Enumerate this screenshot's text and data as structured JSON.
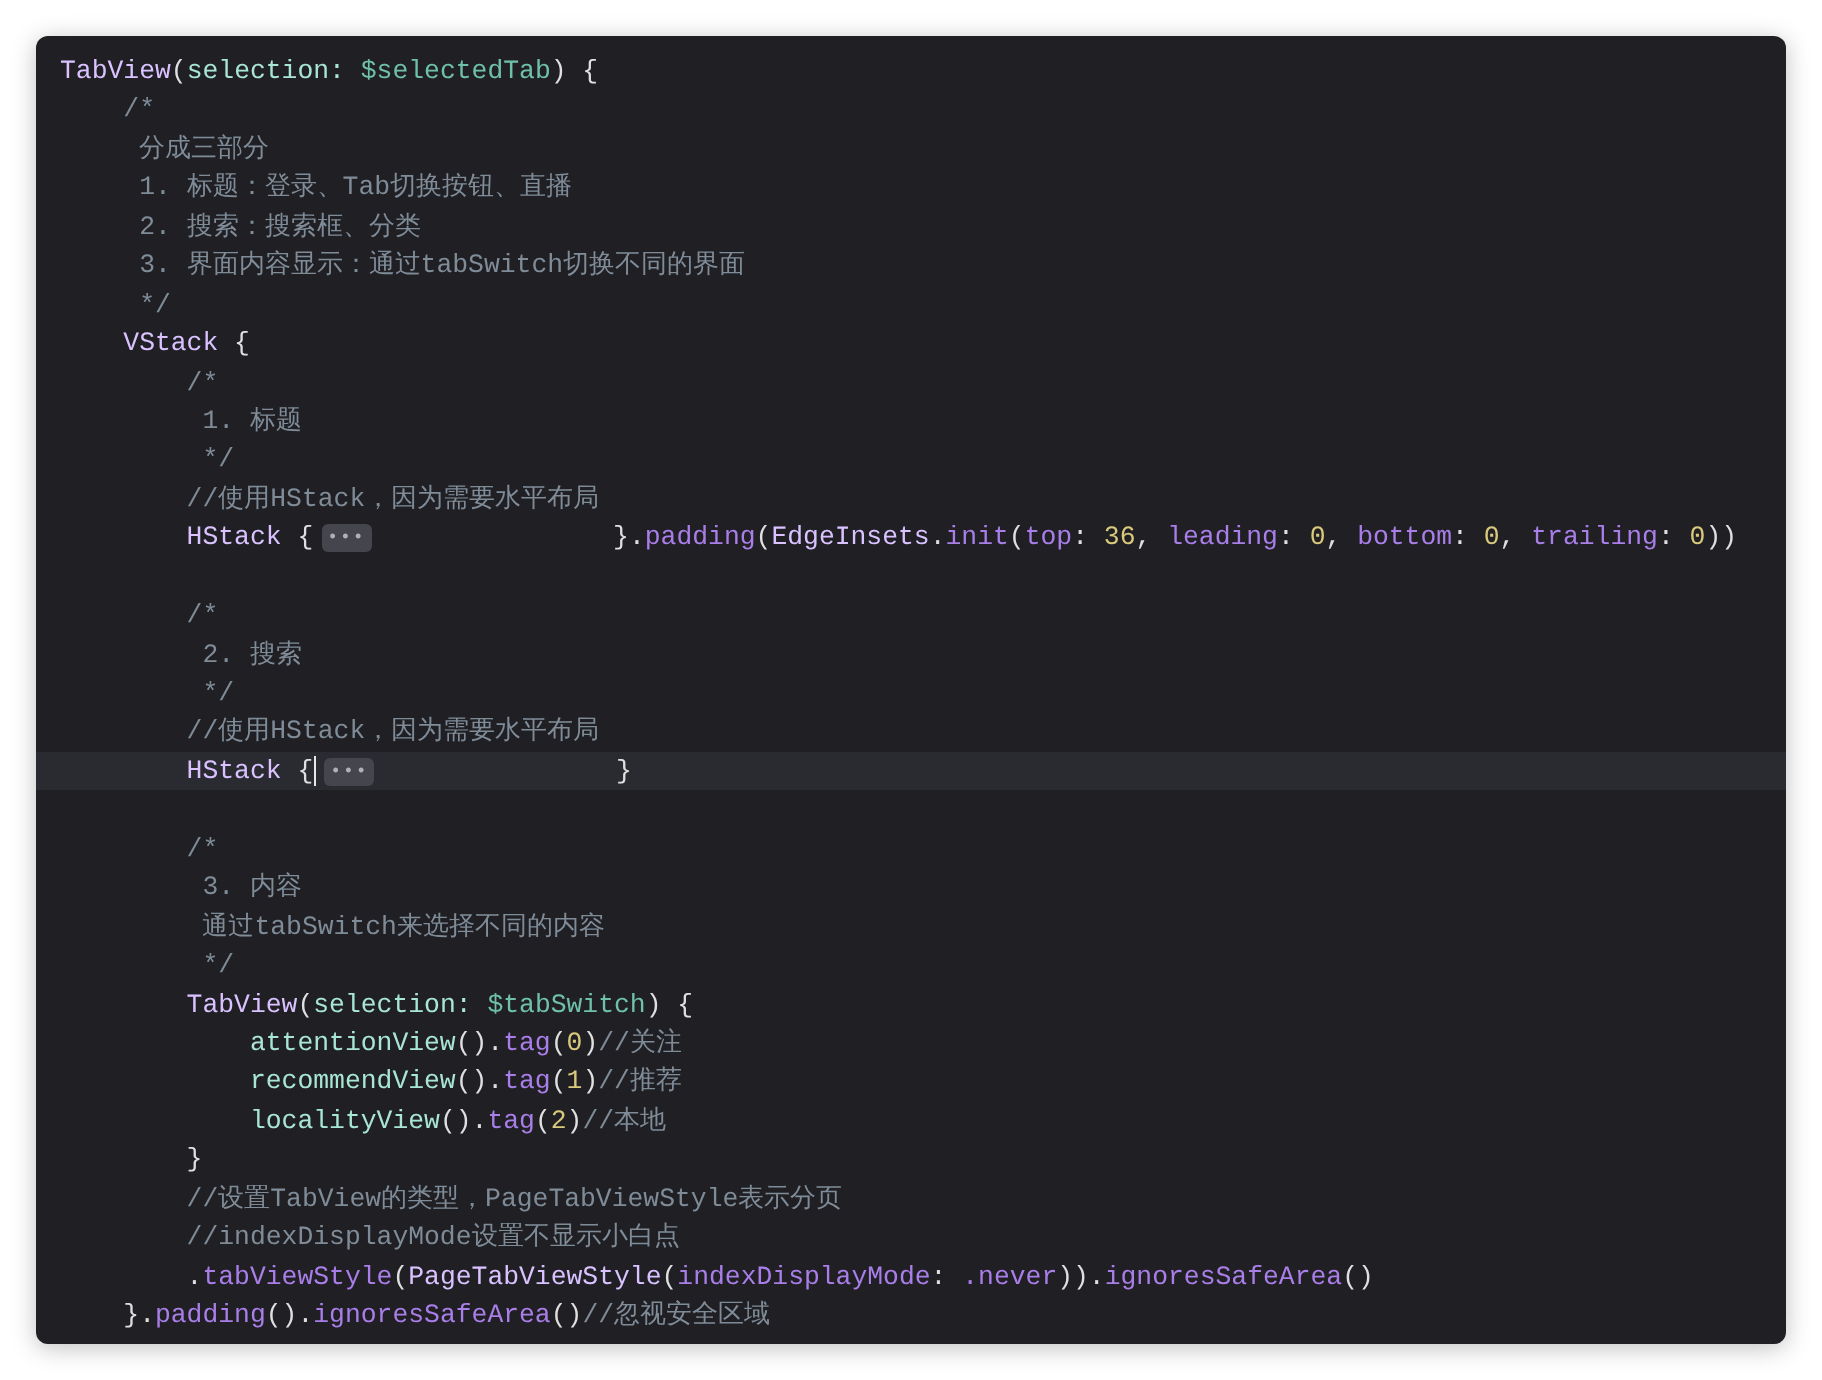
{
  "editor": {
    "lines": [
      {
        "current": false,
        "tokens": [
          {
            "text": "TabView",
            "kind": "type"
          },
          {
            "text": "(",
            "kind": "plain"
          },
          {
            "text": "selection: ",
            "kind": "param"
          },
          {
            "text": "$selectedTab",
            "kind": "var"
          },
          {
            "text": ") {",
            "kind": "plain"
          }
        ]
      },
      {
        "current": false,
        "tokens": [
          {
            "text": "    /*",
            "kind": "comment"
          }
        ]
      },
      {
        "current": false,
        "tokens": [
          {
            "text": "     分成三部分",
            "kind": "comment"
          }
        ]
      },
      {
        "current": false,
        "tokens": [
          {
            "text": "     1. 标题：登录、Tab切换按钮、直播",
            "kind": "comment"
          }
        ]
      },
      {
        "current": false,
        "tokens": [
          {
            "text": "     2. 搜索：搜索框、分类",
            "kind": "comment"
          }
        ]
      },
      {
        "current": false,
        "tokens": [
          {
            "text": "     3. 界面内容显示：通过tabSwitch切换不同的界面",
            "kind": "comment"
          }
        ]
      },
      {
        "current": false,
        "tokens": [
          {
            "text": "     */",
            "kind": "comment"
          }
        ]
      },
      {
        "current": false,
        "tokens": [
          {
            "text": "    VStack",
            "kind": "type"
          },
          {
            "text": " {",
            "kind": "plain"
          }
        ]
      },
      {
        "current": false,
        "tokens": [
          {
            "text": "        /*",
            "kind": "comment"
          }
        ]
      },
      {
        "current": false,
        "tokens": [
          {
            "text": "         1. 标题",
            "kind": "comment"
          }
        ]
      },
      {
        "current": false,
        "tokens": [
          {
            "text": "         */",
            "kind": "comment"
          }
        ]
      },
      {
        "current": false,
        "tokens": [
          {
            "text": "        //使用HStack，因为需要水平布局",
            "kind": "comment"
          }
        ]
      },
      {
        "current": false,
        "tokens": [
          {
            "text": "        HStack",
            "kind": "type"
          },
          {
            "text": " {",
            "kind": "plain"
          },
          {
            "text": "•••",
            "kind": "fold"
          },
          {
            "text": "               }.",
            "kind": "plain"
          },
          {
            "text": "padding",
            "kind": "method"
          },
          {
            "text": "(",
            "kind": "plain"
          },
          {
            "text": "EdgeInsets",
            "kind": "type"
          },
          {
            "text": ".",
            "kind": "plain"
          },
          {
            "text": "init",
            "kind": "method"
          },
          {
            "text": "(",
            "kind": "plain"
          },
          {
            "text": "top",
            "kind": "label"
          },
          {
            "text": ": ",
            "kind": "plain"
          },
          {
            "text": "36",
            "kind": "number"
          },
          {
            "text": ", ",
            "kind": "plain"
          },
          {
            "text": "leading",
            "kind": "label"
          },
          {
            "text": ": ",
            "kind": "plain"
          },
          {
            "text": "0",
            "kind": "number"
          },
          {
            "text": ", ",
            "kind": "plain"
          },
          {
            "text": "bottom",
            "kind": "label"
          },
          {
            "text": ": ",
            "kind": "plain"
          },
          {
            "text": "0",
            "kind": "number"
          },
          {
            "text": ", ",
            "kind": "plain"
          },
          {
            "text": "trailing",
            "kind": "label"
          },
          {
            "text": ": ",
            "kind": "plain"
          },
          {
            "text": "0",
            "kind": "number"
          },
          {
            "text": "))",
            "kind": "plain"
          }
        ]
      },
      {
        "current": false
      },
      {
        "current": false,
        "tokens": [
          {
            "text": "        /*",
            "kind": "comment"
          }
        ]
      },
      {
        "current": false,
        "tokens": [
          {
            "text": "         2. 搜索",
            "kind": "comment"
          }
        ]
      },
      {
        "current": false,
        "tokens": [
          {
            "text": "         */",
            "kind": "comment"
          }
        ]
      },
      {
        "current": false,
        "tokens": [
          {
            "text": "        //使用HStack，因为需要水平布局",
            "kind": "comment"
          }
        ]
      },
      {
        "current": true,
        "tokens": [
          {
            "text": "        HStack",
            "kind": "type"
          },
          {
            "text": " {",
            "kind": "plain"
          },
          {
            "kind": "cursor"
          },
          {
            "text": "•••",
            "kind": "fold"
          },
          {
            "text": "               }",
            "kind": "plain"
          }
        ]
      },
      {
        "current": false
      },
      {
        "current": false,
        "tokens": [
          {
            "text": "        /*",
            "kind": "comment"
          }
        ]
      },
      {
        "current": false,
        "tokens": [
          {
            "text": "         3. 内容",
            "kind": "comment"
          }
        ]
      },
      {
        "current": false,
        "tokens": [
          {
            "text": "         通过tabSwitch来选择不同的内容",
            "kind": "comment"
          }
        ]
      },
      {
        "current": false,
        "tokens": [
          {
            "text": "         */",
            "kind": "comment"
          }
        ]
      },
      {
        "current": false,
        "tokens": [
          {
            "text": "        TabView",
            "kind": "type"
          },
          {
            "text": "(",
            "kind": "plain"
          },
          {
            "text": "selection: ",
            "kind": "param"
          },
          {
            "text": "$tabSwitch",
            "kind": "var"
          },
          {
            "text": ") {",
            "kind": "plain"
          }
        ]
      },
      {
        "current": false,
        "tokens": [
          {
            "text": "            attentionView",
            "kind": "param"
          },
          {
            "text": "().",
            "kind": "plain"
          },
          {
            "text": "tag",
            "kind": "method"
          },
          {
            "text": "(",
            "kind": "plain"
          },
          {
            "text": "0",
            "kind": "number"
          },
          {
            "text": ")",
            "kind": "plain"
          },
          {
            "text": "//关注",
            "kind": "comment"
          }
        ]
      },
      {
        "current": false,
        "tokens": [
          {
            "text": "            recommendView",
            "kind": "param"
          },
          {
            "text": "().",
            "kind": "plain"
          },
          {
            "text": "tag",
            "kind": "method"
          },
          {
            "text": "(",
            "kind": "plain"
          },
          {
            "text": "1",
            "kind": "number"
          },
          {
            "text": ")",
            "kind": "plain"
          },
          {
            "text": "//推荐",
            "kind": "comment"
          }
        ]
      },
      {
        "current": false,
        "tokens": [
          {
            "text": "            localityView",
            "kind": "param"
          },
          {
            "text": "().",
            "kind": "plain"
          },
          {
            "text": "tag",
            "kind": "method"
          },
          {
            "text": "(",
            "kind": "plain"
          },
          {
            "text": "2",
            "kind": "number"
          },
          {
            "text": ")",
            "kind": "plain"
          },
          {
            "text": "//本地",
            "kind": "comment"
          }
        ]
      },
      {
        "current": false,
        "tokens": [
          {
            "text": "        }",
            "kind": "plain"
          }
        ]
      },
      {
        "current": false,
        "tokens": [
          {
            "text": "        //设置TabView的类型，PageTabViewStyle表示分页",
            "kind": "comment"
          }
        ]
      },
      {
        "current": false,
        "tokens": [
          {
            "text": "        //indexDisplayMode设置不显示小白点",
            "kind": "comment"
          }
        ]
      },
      {
        "current": false,
        "tokens": [
          {
            "text": "        .",
            "kind": "plain"
          },
          {
            "text": "tabViewStyle",
            "kind": "method"
          },
          {
            "text": "(",
            "kind": "plain"
          },
          {
            "text": "PageTabViewStyle",
            "kind": "type"
          },
          {
            "text": "(",
            "kind": "plain"
          },
          {
            "text": "indexDisplayMode",
            "kind": "label"
          },
          {
            "text": ": ",
            "kind": "plain"
          },
          {
            "text": ".never",
            "kind": "method"
          },
          {
            "text": ")).",
            "kind": "plain"
          },
          {
            "text": "ignoresSafeArea",
            "kind": "method"
          },
          {
            "text": "()",
            "kind": "plain"
          }
        ]
      },
      {
        "current": false,
        "tokens": [
          {
            "text": "    }.",
            "kind": "plain"
          },
          {
            "text": "padding",
            "kind": "method"
          },
          {
            "text": "().",
            "kind": "plain"
          },
          {
            "text": "ignoresSafeArea",
            "kind": "method"
          },
          {
            "text": "()",
            "kind": "plain"
          },
          {
            "text": "//忽视安全区域",
            "kind": "comment"
          }
        ]
      }
    ]
  }
}
